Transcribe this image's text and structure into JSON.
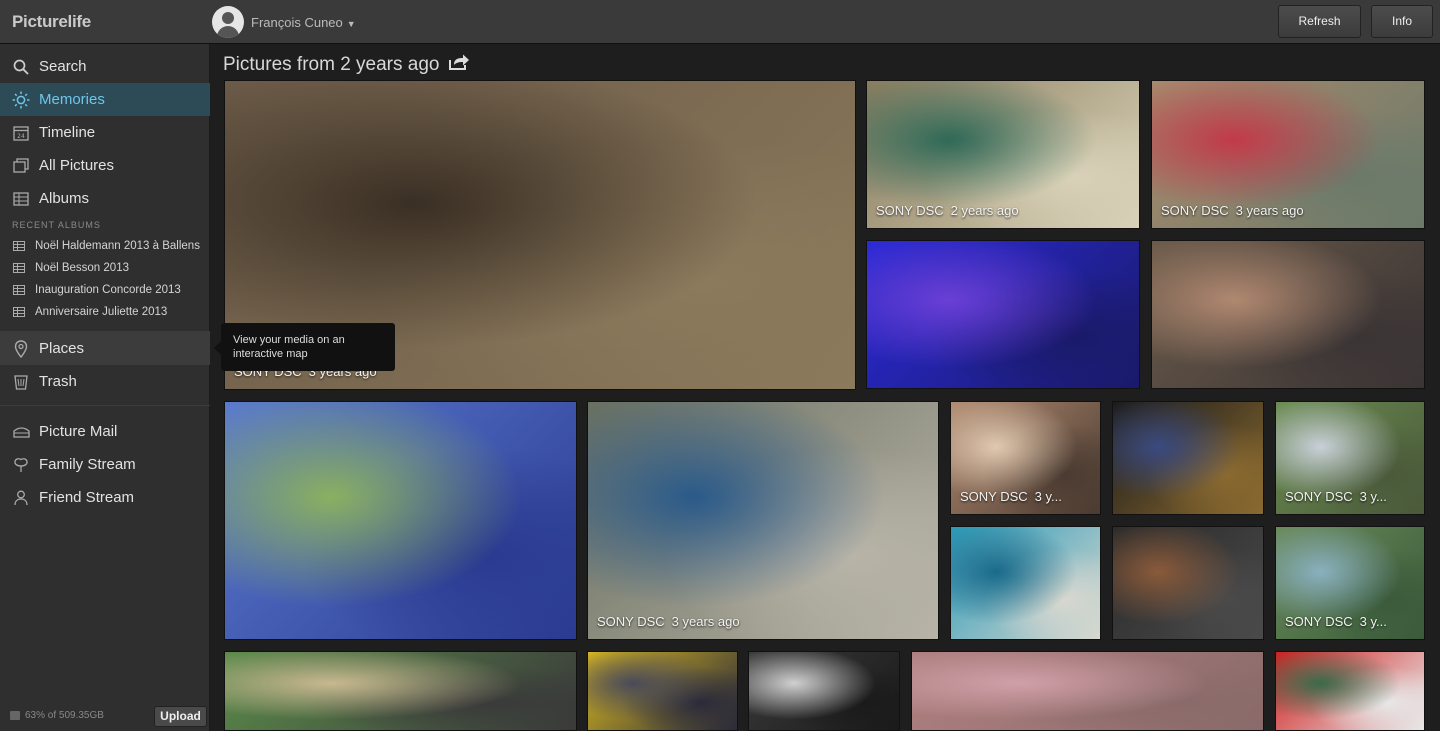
{
  "app": {
    "logo": "Picturelife"
  },
  "user": {
    "name": "François Cuneo"
  },
  "toolbar": {
    "refresh_label": "Refresh",
    "info_label": "Info"
  },
  "sidebar": {
    "main_items": [
      {
        "label": "Search",
        "icon": "search-icon"
      },
      {
        "label": "Memories",
        "icon": "sun-icon",
        "active": true
      },
      {
        "label": "Timeline",
        "icon": "calendar-icon"
      },
      {
        "label": "All Pictures",
        "icon": "stack-icon"
      },
      {
        "label": "Albums",
        "icon": "album-grid-icon"
      }
    ],
    "recent_albums_label": "RECENT ALBUMS",
    "recent_albums": [
      "Noël Haldemann 2013 à Ballens",
      "Noël Besson 2013",
      "Inauguration Concorde 2013",
      "Anniversaire Juliette 2013"
    ],
    "places": "Places",
    "trash": "Trash",
    "social_items": [
      {
        "label": "Picture Mail",
        "icon": "mail-icon"
      },
      {
        "label": "Family Stream",
        "icon": "family-icon"
      },
      {
        "label": "Friend Stream",
        "icon": "person-icon"
      }
    ],
    "storage": "63% of 509.35GB",
    "upload_label": "Upload"
  },
  "tooltip": "View your media on an interactive map",
  "main": {
    "title": "Pictures from 2 years ago",
    "photos": [
      {
        "name": "SONY DSC",
        "age": "3 years ago",
        "colors": [
          "#6b5a47",
          "#3a2f24",
          "#8c7a5c"
        ]
      },
      {
        "name": "SONY DSC",
        "age": "2 years ago",
        "colors": [
          "#8a7c5e",
          "#2f6a58",
          "#d9d2b8"
        ]
      },
      {
        "name": "SONY DSC",
        "age": "3 years ago",
        "colors": [
          "#a88a6c",
          "#c23a4a",
          "#6b7a6a"
        ]
      },
      {
        "name": "",
        "age": "",
        "colors": [
          "#2a2ad8",
          "#6a3fd6",
          "#1a1a6a"
        ]
      },
      {
        "name": "",
        "age": "",
        "colors": [
          "#6a5a4a",
          "#b08870",
          "#3a3434"
        ]
      },
      {
        "name": "",
        "age": "",
        "colors": [
          "#5a7ad0",
          "#8ab060",
          "#2a3a90"
        ]
      },
      {
        "name": "SONY DSC",
        "age": "3 years ago",
        "colors": [
          "#6a7060",
          "#2a5a8a",
          "#b8b4a8"
        ]
      },
      {
        "name": "SONY DSC",
        "age": "3 y...",
        "colors": [
          "#b08a70",
          "#e0c8b0",
          "#4a3a30"
        ]
      },
      {
        "name": "",
        "age": "",
        "colors": [
          "#1a1a1a",
          "#3a4a80",
          "#8a6a30"
        ]
      },
      {
        "name": "SONY DSC",
        "age": "3 y...",
        "colors": [
          "#6a8a50",
          "#c8d0d8",
          "#4a5a3a"
        ]
      },
      {
        "name": "",
        "age": "",
        "colors": [
          "#2a9ab8",
          "#1a6a8a",
          "#d8d8d0"
        ]
      },
      {
        "name": "",
        "age": "",
        "colors": [
          "#2a2a2a",
          "#8a5a3a",
          "#4a4a4a"
        ]
      },
      {
        "name": "SONY DSC",
        "age": "3 y...",
        "colors": [
          "#6a8a5a",
          "#8ab0c0",
          "#3a5a3a"
        ]
      },
      {
        "name": "",
        "age": "",
        "colors": [
          "#5a8a4a",
          "#c8b890",
          "#3a3a3a"
        ]
      },
      {
        "name": "",
        "age": "",
        "colors": [
          "#d8b820",
          "#4a4a5a",
          "#2a2a3a"
        ]
      },
      {
        "name": "",
        "age": "",
        "colors": [
          "#3a3a3a",
          "#d0d0d0",
          "#1a1a1a"
        ]
      },
      {
        "name": "",
        "age": "",
        "colors": [
          "#b08080",
          "#d0a0a8",
          "#8a6a6a"
        ]
      },
      {
        "name": "",
        "age": "",
        "colors": [
          "#d02020",
          "#3a6a4a",
          "#e8e8e8"
        ]
      }
    ]
  },
  "theme": {
    "accent": "#6ec6e8",
    "active_bg": "#2d4a57",
    "sidebar_bg": "#2f2f2f",
    "topbar_bg": "#3a3a3a"
  }
}
